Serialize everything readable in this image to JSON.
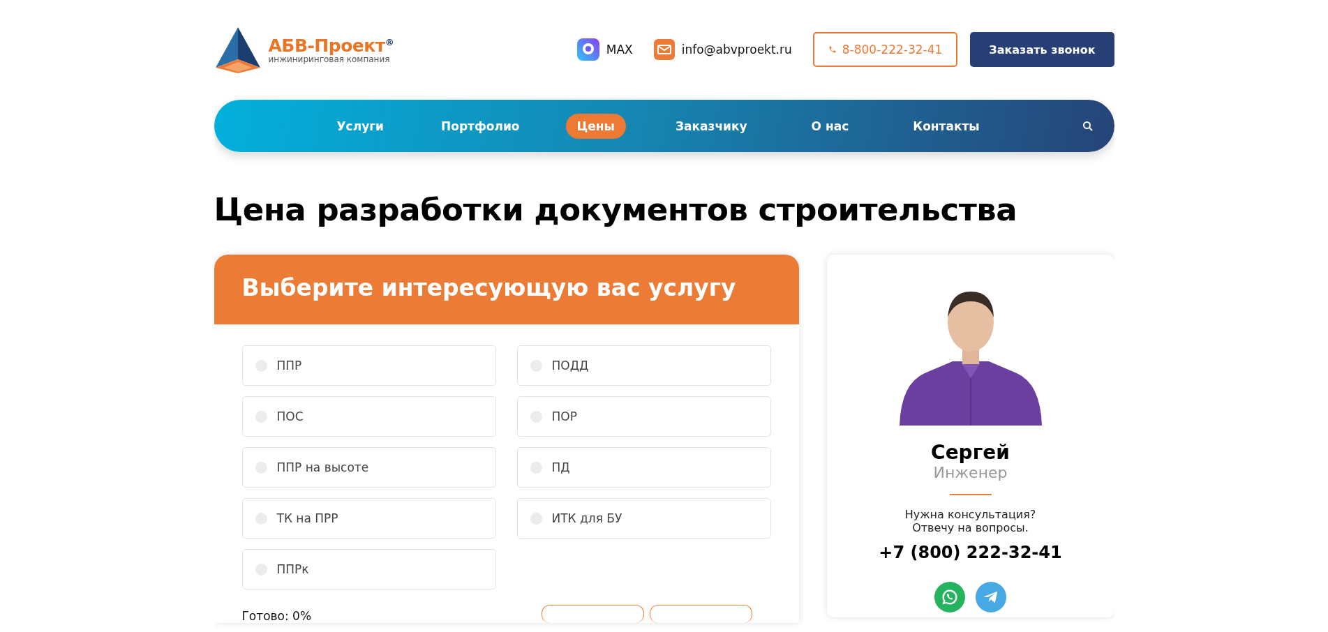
{
  "header": {
    "logo": {
      "name": "АБВ-Проект",
      "mark": "®",
      "tagline": "инжиниринговая компания"
    },
    "messenger": {
      "label": "MAX"
    },
    "email": "info@abvproekt.ru",
    "phone_button": "8-800-222-32-41",
    "callback_button": "Заказать звонок"
  },
  "nav": {
    "items": [
      {
        "label": "Услуги",
        "selected": false
      },
      {
        "label": "Портфолио",
        "selected": false
      },
      {
        "label": "Цены",
        "selected": true
      },
      {
        "label": "Заказчику",
        "selected": false
      },
      {
        "label": "О нас",
        "selected": false
      },
      {
        "label": "Контакты",
        "selected": false
      }
    ]
  },
  "page_title": "Цена разработки документов строительства",
  "service_form": {
    "title": "Выберите интересующую вас услугу",
    "options": [
      {
        "label": "ППР",
        "selected": false
      },
      {
        "label": "ПОДД",
        "selected": false
      },
      {
        "label": "ПОС",
        "selected": false
      },
      {
        "label": "ПОР",
        "selected": false
      },
      {
        "label": "ППР на высоте",
        "selected": false
      },
      {
        "label": "ПД",
        "selected": false
      },
      {
        "label": "ТК на ПРР",
        "selected": false
      },
      {
        "label": "ИТК для БУ",
        "selected": false
      },
      {
        "label": "ППРк",
        "selected": false
      }
    ],
    "progress": "Готово: 0%"
  },
  "consultant": {
    "name": "Сергей",
    "role": "Инженер",
    "message": [
      "Нужна консультация?",
      "Отвечу на вопросы."
    ],
    "phone": "+7 (800) 222-32-41",
    "messengers": [
      {
        "kind": "whatsapp",
        "color": "#25b360"
      },
      {
        "kind": "telegram",
        "color": "#46a9e3"
      }
    ]
  }
}
